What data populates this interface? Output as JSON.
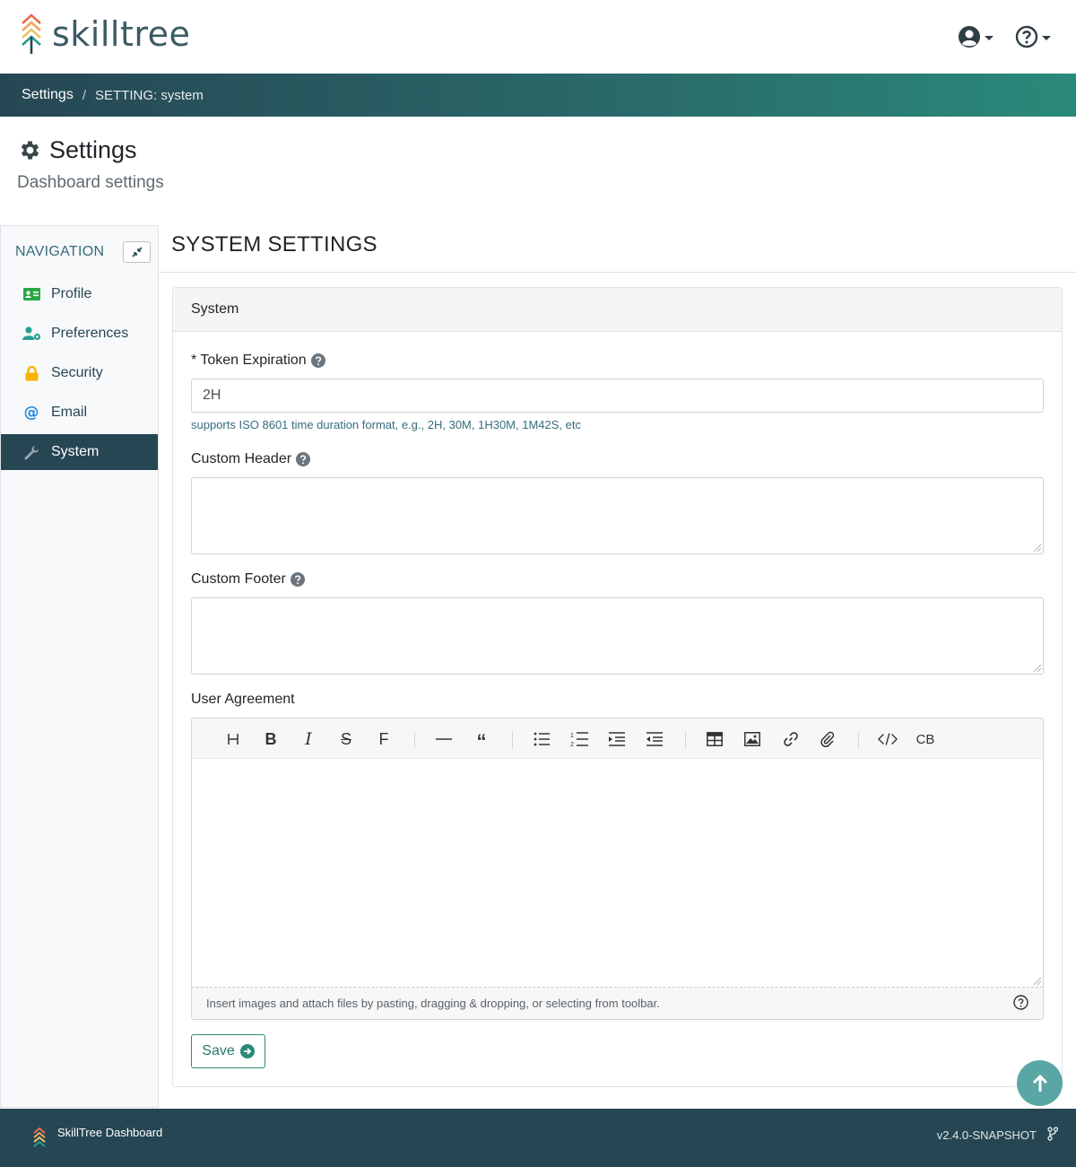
{
  "app": {
    "brand": "skilltree",
    "user_icon": "user-circle-icon",
    "help_icon": "question-circle-icon"
  },
  "breadcrumb": {
    "root": "Settings",
    "current": "SETTING: system"
  },
  "page": {
    "title": "Settings",
    "subtitle": "Dashboard settings"
  },
  "sidebar": {
    "heading": "NAVIGATION",
    "items": [
      {
        "label": "Profile",
        "icon": "id-card-icon"
      },
      {
        "label": "Preferences",
        "icon": "user-cog-icon"
      },
      {
        "label": "Security",
        "icon": "lock-icon"
      },
      {
        "label": "Email",
        "icon": "at-icon"
      },
      {
        "label": "System",
        "icon": "wrench-icon",
        "active": true
      }
    ]
  },
  "main": {
    "section_title": "SYSTEM SETTINGS",
    "card_title": "System",
    "token_label": "* Token Expiration",
    "token_value": "2H",
    "token_help": "supports ISO 8601 time duration format, e.g., 2H, 30M, 1H30M, 1M42S, etc",
    "header_label": "Custom Header",
    "footer_label": "Custom Footer",
    "agreement_label": "User Agreement",
    "editor_hint": "Insert images and attach files by pasting, dragging & dropping, or selecting from toolbar.",
    "toolbar": [
      "heading",
      "bold",
      "italic",
      "strike",
      "font",
      "hr",
      "quote",
      "ul",
      "ol",
      "indent",
      "outdent",
      "table",
      "image",
      "link",
      "attach",
      "code",
      "codeblock"
    ],
    "codeblock_label": "CB",
    "save_label": "Save"
  },
  "footer": {
    "name": "SkillTree Dashboard",
    "version": "v2.4.0-SNAPSHOT"
  },
  "colors": {
    "primary": "#264653",
    "teal": "#2a8a7a",
    "security": "#f4b400",
    "email": "#1e88e5"
  }
}
